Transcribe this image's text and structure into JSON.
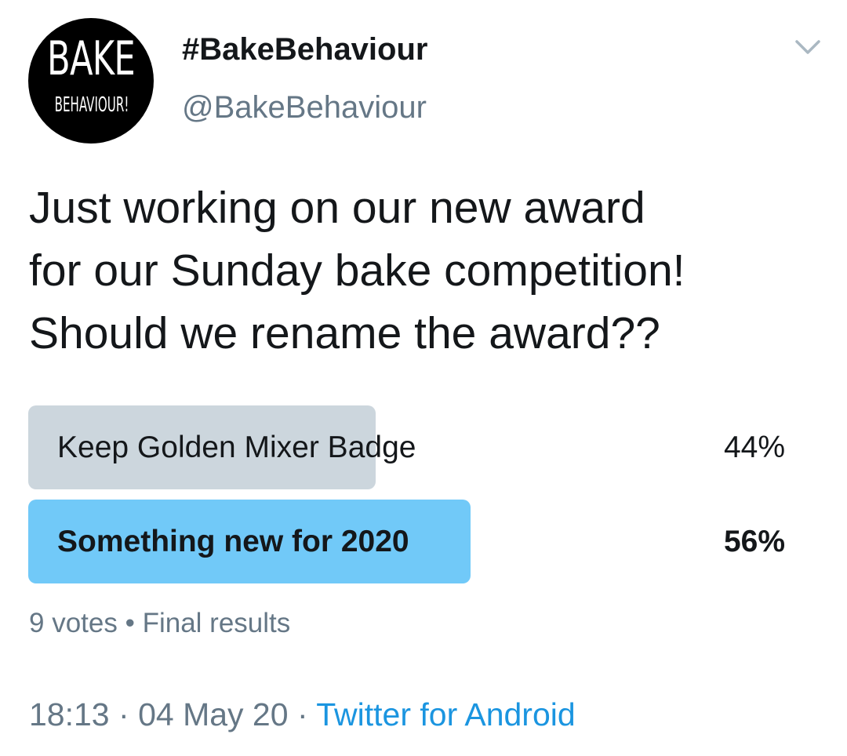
{
  "account": {
    "avatar": {
      "logo_line_1": "BAKE",
      "logo_line_2": "BEHAVIOUR!",
      "icon": "avatar-logo"
    },
    "display_name": "#BakeBehaviour",
    "handle": "@BakeBehaviour",
    "menu_icon": "chevron-down-icon"
  },
  "tweet": {
    "text_lines": [
      "Just working on our new award",
      "for our Sunday bake competition!",
      "Should we rename the award??"
    ]
  },
  "poll": {
    "options": [
      {
        "label": "Keep Golden Mixer Badge",
        "percent_text": "44%",
        "fill_fraction": 0.44,
        "winner": false
      },
      {
        "label": "Something new for 2020",
        "percent_text": "56%",
        "fill_fraction": 0.56,
        "winner": true
      }
    ],
    "votes": "9 votes",
    "separator": "•",
    "status": "Final results"
  },
  "meta": {
    "time": "18:13",
    "dot": "·",
    "date": "04 May 20",
    "source": "Twitter for Android"
  },
  "colors": {
    "loser_bar": "#ccd6dd",
    "winner_bar": "#71c9f8",
    "secondary_text": "#657786",
    "link": "#1b95e0",
    "primary_text": "#14171a"
  }
}
